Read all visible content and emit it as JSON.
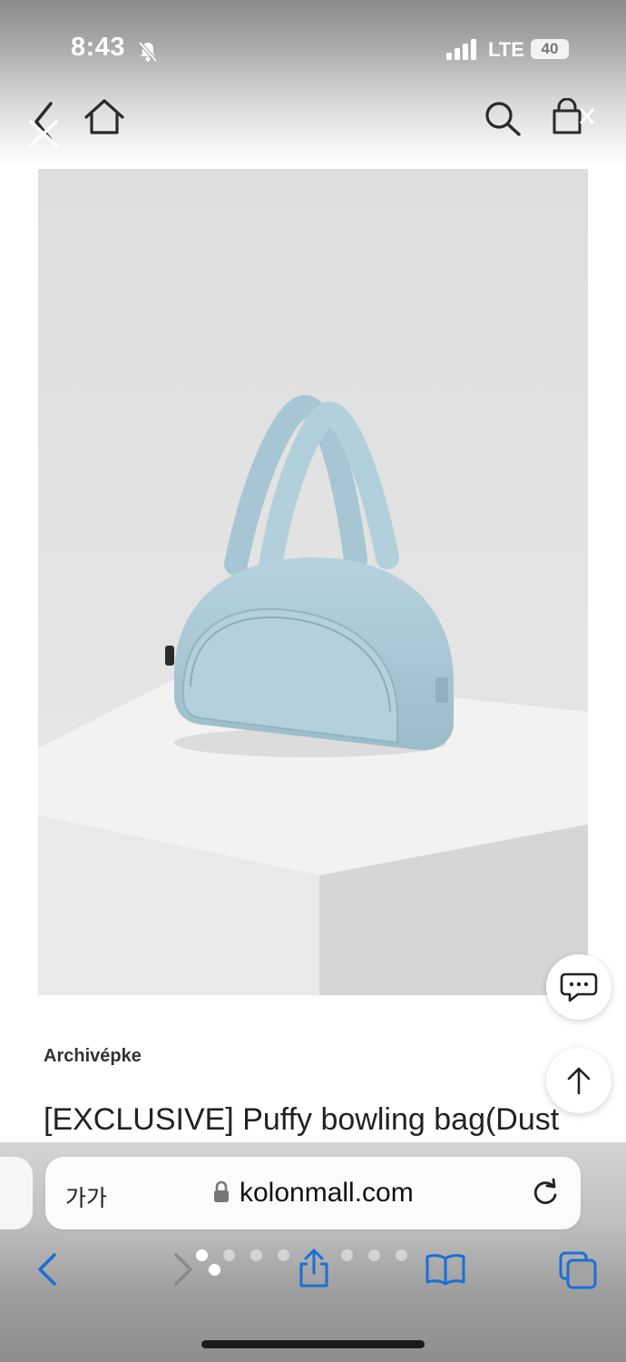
{
  "status": {
    "time": "8:43",
    "network": "LTE",
    "battery": "40"
  },
  "header": {
    "icons": [
      "back-icon",
      "close-icon",
      "home-icon",
      "search-icon",
      "cart-icon"
    ]
  },
  "gallery": {
    "image_count": 10,
    "active_index": 1
  },
  "product": {
    "brand": "Archivépke",
    "title": "[EXCLUSIVE] Puffy bowling bag(Dust"
  },
  "browser": {
    "text_size_label": "가가",
    "url": "kolonmall.com",
    "tab_page_dots": 8,
    "tab_page_active": 0
  },
  "colors": {
    "accent": "#1a6fd6",
    "bag": "#a9c8d5"
  }
}
